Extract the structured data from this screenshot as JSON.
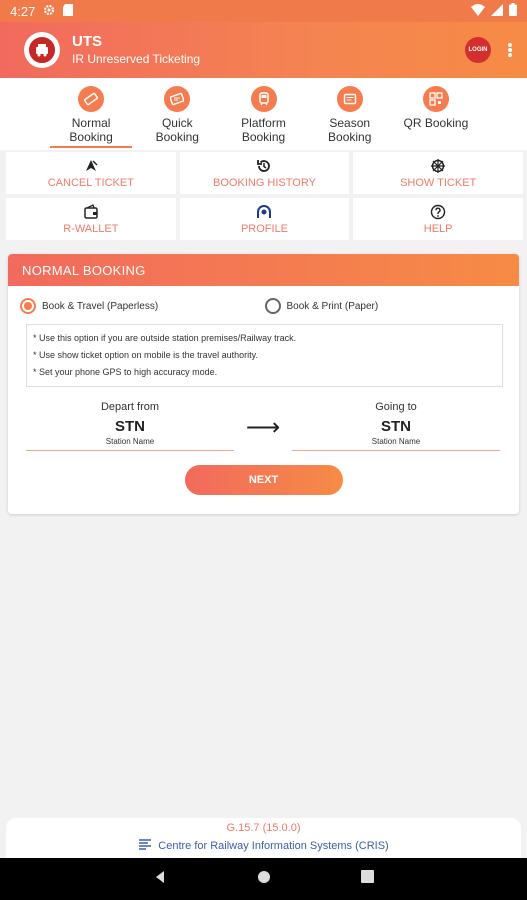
{
  "status_bar": {
    "time": "4:27"
  },
  "app_bar": {
    "title": "UTS",
    "subtitle": "IR Unreserved Ticketing",
    "login_label": "LOGIN"
  },
  "tabs": [
    {
      "label": "Normal Booking",
      "icon": "ticket-icon",
      "active": true
    },
    {
      "label": "Quick Booking",
      "icon": "quick-ticket-icon",
      "active": false
    },
    {
      "label": "Platform Booking",
      "icon": "train-icon",
      "active": false
    },
    {
      "label": "Season Booking",
      "icon": "season-ticket-icon",
      "active": false
    },
    {
      "label": "QR Booking",
      "icon": "qr-icon",
      "active": false
    }
  ],
  "actions": [
    {
      "label": "CANCEL TICKET",
      "icon": "cancel-ticket-icon"
    },
    {
      "label": "BOOKING HISTORY",
      "icon": "history-icon"
    },
    {
      "label": "SHOW TICKET",
      "icon": "show-ticket-icon"
    },
    {
      "label": "R-WALLET",
      "icon": "wallet-icon"
    },
    {
      "label": "PROFILE",
      "icon": "profile-icon"
    },
    {
      "label": "HELP",
      "icon": "help-icon"
    }
  ],
  "booking": {
    "header": "NORMAL BOOKING",
    "options": [
      {
        "label": "Book & Travel (Paperless)",
        "selected": true
      },
      {
        "label": "Book & Print (Paper)",
        "selected": false
      }
    ],
    "notes": [
      "* Use this option if you are outside station premises/Railway track.",
      "* Use show ticket option on mobile is the travel authority.",
      "* Set your phone GPS to high accuracy mode."
    ],
    "from": {
      "label": "Depart from",
      "code": "STN",
      "name": "Station Name"
    },
    "to": {
      "label": "Going to",
      "code": "STN",
      "name": "Station Name"
    },
    "arrow": "⟶",
    "next_label": "NEXT"
  },
  "footer": {
    "version": "G.15.7 (15.0.0)",
    "org": "Centre for Railway Information Systems (CRIS)"
  },
  "colors": {
    "accent": "#f47c4e",
    "header_start": "#f26a5e",
    "header_end": "#f68b45",
    "action_text": "#f07a6a",
    "footer_link": "#3b5fa8"
  }
}
